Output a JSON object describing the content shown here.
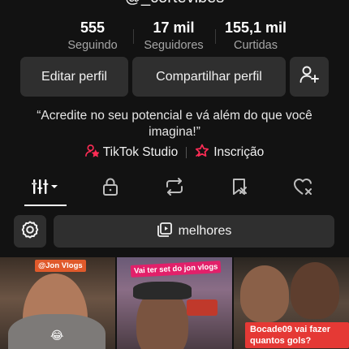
{
  "profile": {
    "username": "@_cortevibes",
    "stats": [
      {
        "value": "555",
        "label": "Seguindo"
      },
      {
        "value": "17 mil",
        "label": "Seguidores"
      },
      {
        "value": "155,1 mil",
        "label": "Curtidas"
      }
    ],
    "edit_label": "Editar perfil",
    "share_label": "Compartilhar perfil",
    "bio": "“Acredite no seu potencial e vá além do que você imagina!”",
    "links": {
      "studio": "TikTok Studio",
      "subscription": "Inscrição"
    }
  },
  "tabs": [
    {
      "name": "videos-grid",
      "icon": "grid-bars-icon",
      "active": true
    },
    {
      "name": "private",
      "icon": "lock-icon",
      "active": false
    },
    {
      "name": "reposts",
      "icon": "repost-icon",
      "active": false
    },
    {
      "name": "favorites",
      "icon": "bookmark-icon",
      "active": false
    },
    {
      "name": "liked",
      "icon": "heart-icon",
      "active": false
    }
  ],
  "playlist": {
    "label": "melhores"
  },
  "videos": [
    {
      "caption": "@Jon Vlogs"
    },
    {
      "caption": "Vai ter set do jon vlogs"
    },
    {
      "caption": "Bocade09 vai fazer quantos gols?"
    }
  ],
  "colors": {
    "background": "#121212",
    "button": "#2f2f2f",
    "accent": "#fe2c55"
  }
}
